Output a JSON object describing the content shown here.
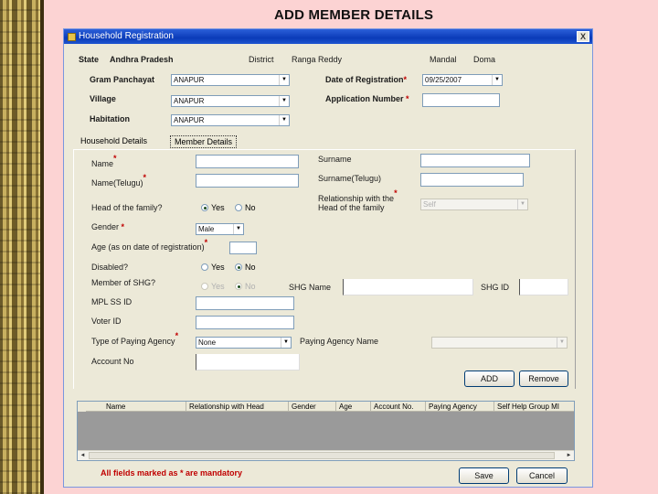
{
  "slide_title": "ADD MEMBER DETAILS",
  "window": {
    "title": "Household Registration",
    "close_glyph": "X"
  },
  "header": {
    "state_label": "State",
    "state_value": "Andhra Pradesh",
    "district_label": "District",
    "district_value": "Ranga Reddy",
    "mandal_label": "Mandal",
    "mandal_value": "Doma"
  },
  "location": {
    "gram_panchayat_label": "Gram Panchayat",
    "gram_panchayat_value": "ANAPUR",
    "village_label": "Village",
    "village_value": "ANAPUR",
    "habitation_label": "Habitation",
    "habitation_value": "ANAPUR",
    "date_of_registration_label": "Date of Registration",
    "date_of_registration_value": "09/25/2007",
    "application_number_label": "Application Number",
    "application_number_value": ""
  },
  "tabs": [
    {
      "label": "Household Details"
    },
    {
      "label": "Member Details"
    }
  ],
  "member": {
    "name_label": "Name",
    "surname_label": "Surname",
    "name_telugu_label": "Name(Telugu)",
    "surname_telugu_label": "Surname(Telugu)",
    "head_of_family_label": "Head of the family?",
    "relationship_label_line1": "Relationship with the",
    "relationship_label_line2": "Head of the family",
    "relationship_value": "Self",
    "yes_label": "Yes",
    "no_label": "No",
    "gender_label": "Gender",
    "gender_value": "Male",
    "age_label": "Age (as on date of registration)",
    "age_value": "",
    "disabled_label": "Disabled?",
    "member_of_shg_label": "Member of SHG?",
    "shg_name_label": "SHG Name",
    "shg_id_label": "SHG ID",
    "mpl_ssid_label": "MPL SS ID",
    "voter_id_label": "Voter ID",
    "type_paying_agency_label": "Type of Paying Agency",
    "type_paying_agency_value": "None",
    "paying_agency_name_label": "Paying Agency Name",
    "paying_agency_name_value": "",
    "account_no_label": "Account No",
    "add_button": "ADD",
    "remove_button": "Remove"
  },
  "grid": {
    "columns": [
      "Name",
      "Relationship with Head",
      "Gender",
      "Age",
      "Account No.",
      "Paying Agency",
      "Self Help Group MI"
    ]
  },
  "footer": {
    "mandatory_note": "All fields marked as * are mandatory",
    "save_button": "Save",
    "cancel_button": "Cancel"
  },
  "required_marker": "*",
  "arrow_glyph": "▼",
  "left_arrow": "◄",
  "right_arrow": "►",
  "colors": {
    "slide_background": "#fcd3d3",
    "window_background": "#ece9d8",
    "titlebar": "#0a3bb8",
    "required": "#c00000"
  }
}
